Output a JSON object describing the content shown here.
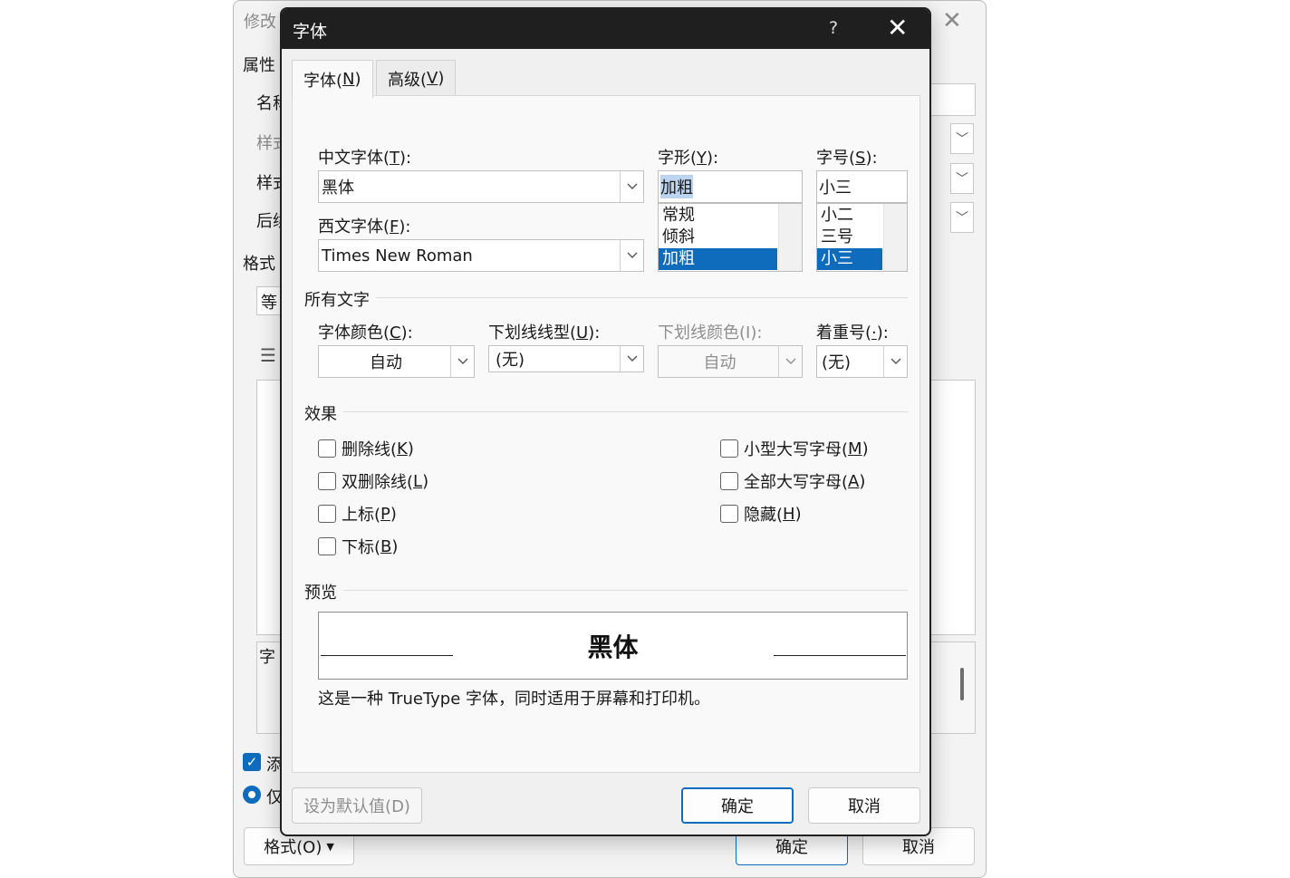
{
  "bg_dialog": {
    "title_fragment": "修改",
    "properties": "属性",
    "name": "名称",
    "style_type": "样式",
    "style_based": "样式",
    "next_para": "后续",
    "format": "格式",
    "font_box": "等",
    "desc_fragment": "字",
    "add_gallery": "添",
    "only_doc": "仅",
    "format_button": "格式(O)",
    "ok": "确定",
    "cancel": "取消",
    "close_glyph": "✕"
  },
  "dialog": {
    "title": "字体",
    "help": "?",
    "close_glyph": "✕",
    "tabs": [
      {
        "label": "字体(",
        "key": "N",
        "end": ")"
      },
      {
        "label": "高级(",
        "key": "V",
        "end": ")"
      }
    ],
    "cn_font": {
      "label": "中文字体(",
      "key": "T",
      "end": "):",
      "value": "黑体"
    },
    "west_font": {
      "label": "西文字体(",
      "key": "F",
      "end": "):",
      "value": "Times New Roman"
    },
    "style": {
      "label": "字形(",
      "key": "Y",
      "end": "):",
      "value": "加粗",
      "options": [
        "常规",
        "倾斜",
        "加粗"
      ]
    },
    "size": {
      "label": "字号(",
      "key": "S",
      "end": "):",
      "value": "小三",
      "options": [
        "小二",
        "三号",
        "小三"
      ]
    },
    "all_text": "所有文字",
    "font_color": {
      "label": "字体颜色(",
      "key": "C",
      "end": "):",
      "value": "自动"
    },
    "underline_style": {
      "label": "下划线线型(",
      "key": "U",
      "end": "):",
      "value": "(无)"
    },
    "underline_color": {
      "label": "下划线颜色(I):",
      "value": "自动"
    },
    "emphasis": {
      "label": "着重号(",
      "key": "·",
      "end": "):",
      "value": "(无)"
    },
    "effects": "效果",
    "checkboxes_left": [
      {
        "label": "删除线(",
        "key": "K",
        "end": ")"
      },
      {
        "label": "双删除线(",
        "key": "L",
        "end": ")"
      },
      {
        "label": "上标(",
        "key": "P",
        "end": ")"
      },
      {
        "label": "下标(",
        "key": "B",
        "end": ")"
      }
    ],
    "checkboxes_right": [
      {
        "label": "小型大写字母(",
        "key": "M",
        "end": ")"
      },
      {
        "label": "全部大写字母(",
        "key": "A",
        "end": ")"
      },
      {
        "label": "隐藏(",
        "key": "H",
        "end": ")"
      }
    ],
    "preview": "预览",
    "preview_text": "黑体",
    "preview_note": "这是一种 TrueType 字体，同时适用于屏幕和打印机。",
    "set_default": "设为默认值(D)",
    "ok": "确定",
    "cancel": "取消"
  }
}
